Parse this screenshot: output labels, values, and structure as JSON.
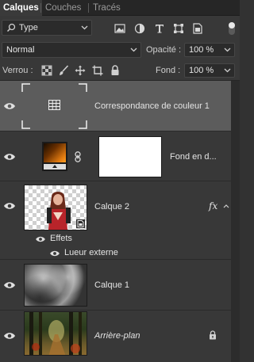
{
  "tabs": [
    {
      "label": "Calques"
    },
    {
      "label": "Couches"
    },
    {
      "label": "Tracés"
    }
  ],
  "filter": {
    "kind_label": "Type"
  },
  "blend": {
    "mode": "Normal",
    "opacity_label": "Opacité :",
    "opacity_value": "100 %",
    "lock_label": "Verrou :",
    "fill_label": "Fond :",
    "fill_value": "100 %"
  },
  "layers": [
    {
      "name": "Correspondance de couleur 1",
      "type": "adjustment",
      "selected": true
    },
    {
      "name": "Fond en d...",
      "type": "gradient-fill-with-mask"
    },
    {
      "name": "Calque 2",
      "type": "pixel",
      "fx": "fx",
      "effects_label": "Effets",
      "effects": [
        {
          "name": "Lueur externe"
        }
      ]
    },
    {
      "name": "Calque 1",
      "type": "pixel"
    },
    {
      "name": "Arrière-plan",
      "type": "background",
      "italic": true,
      "locked": true
    }
  ],
  "colors": {
    "panel_bg": "#383838",
    "selected_bg": "#5c5c5c",
    "tabbar_bg": "#262626",
    "text": "#e4e4e4"
  }
}
